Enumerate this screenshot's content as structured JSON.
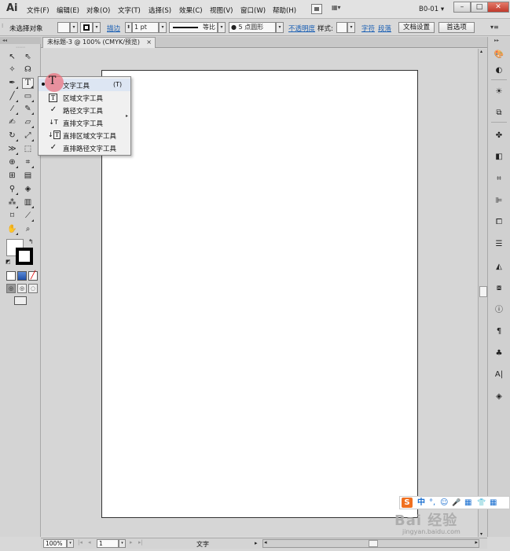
{
  "app": {
    "logo": "Ai",
    "workspace": "B0-01 ▾"
  },
  "menubar": {
    "items": [
      "文件(F)",
      "编辑(E)",
      "对象(O)",
      "文字(T)",
      "选择(S)",
      "效果(C)",
      "视图(V)",
      "窗口(W)",
      "帮助(H)"
    ],
    "arrange_icon": "arrange-documents-icon",
    "window_buttons": [
      "–",
      "□",
      "✕"
    ]
  },
  "controlbar": {
    "selection_status": "未选择对象",
    "stroke_label": "描边",
    "stroke_weight": "1 pt",
    "stroke_profile": "等比",
    "brush": "● 5 点圆形",
    "opacity_label": "不透明度",
    "style_label": "样式:",
    "char_label": "字符",
    "para_label": "段落",
    "doc_setup_button": "文档设置",
    "prefs_button": "首选项"
  },
  "document": {
    "tab_title": "未标题-3 @ 100% (CMYK/预览)",
    "tab_close": "×"
  },
  "flyout": {
    "items": [
      {
        "icon": "T",
        "label": "文字工具",
        "shortcut": "(T)"
      },
      {
        "icon": "T⃞",
        "label": "区域文字工具",
        "shortcut": ""
      },
      {
        "icon": "✓",
        "label": "路径文字工具",
        "shortcut": ""
      },
      {
        "icon": "↓T",
        "label": "直排文字工具",
        "shortcut": ""
      },
      {
        "icon": "↓T⃞",
        "label": "直排区域文字工具",
        "shortcut": ""
      },
      {
        "icon": "✓",
        "label": "直排路径文字工具",
        "shortcut": ""
      }
    ],
    "expand_glyph": "▸"
  },
  "statusbar": {
    "zoom": "100%",
    "page": "1",
    "label": "文字"
  },
  "overlay": {
    "ime_logo": "S",
    "ime_items": [
      "中",
      "°,",
      "☺",
      "🎤",
      "▦",
      "👕",
      "▦"
    ],
    "brand": "Bai 经验",
    "url": "jingyan.baidu.com"
  },
  "colors": {
    "accent": "#1a5fb4",
    "highlight": "#ec6270",
    "close": "#c0392b"
  }
}
